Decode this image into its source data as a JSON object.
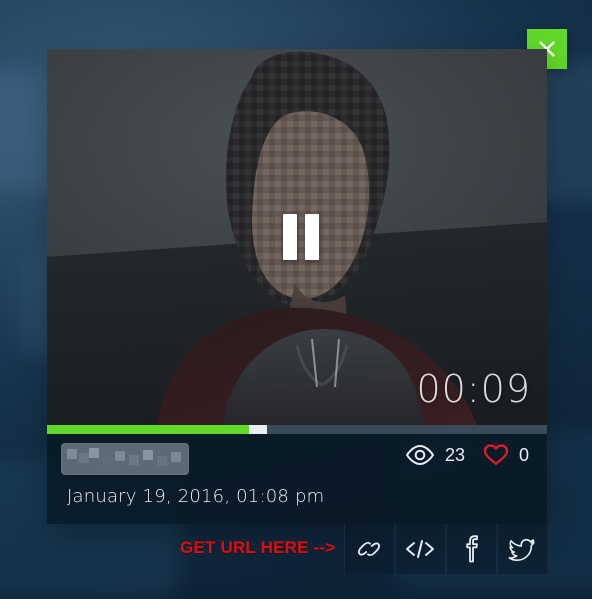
{
  "ui": {
    "accent_green": "#62d82a",
    "heart_red": "#e51c2a",
    "annotation_red": "#e10c0c",
    "text_primary": "#e7eef4"
  },
  "video": {
    "elapsed": "00:09",
    "progress": {
      "played_fraction": 0.404,
      "buffered_end_fraction": 0.44
    }
  },
  "meta": {
    "views_count": "23",
    "likes_count": "0",
    "date_time": "January 19, 2016, 01:08 pm"
  },
  "share": {
    "annotation": "GET URL HERE -->",
    "buttons": [
      {
        "name": "link",
        "icon": "link-icon"
      },
      {
        "name": "embed",
        "icon": "code-icon"
      },
      {
        "name": "facebook",
        "icon": "facebook-icon"
      },
      {
        "name": "twitter",
        "icon": "twitter-icon"
      }
    ]
  },
  "icons": {
    "close": "close-icon",
    "pause": "pause-icon",
    "views": "eye-icon",
    "likes": "heart-icon"
  }
}
